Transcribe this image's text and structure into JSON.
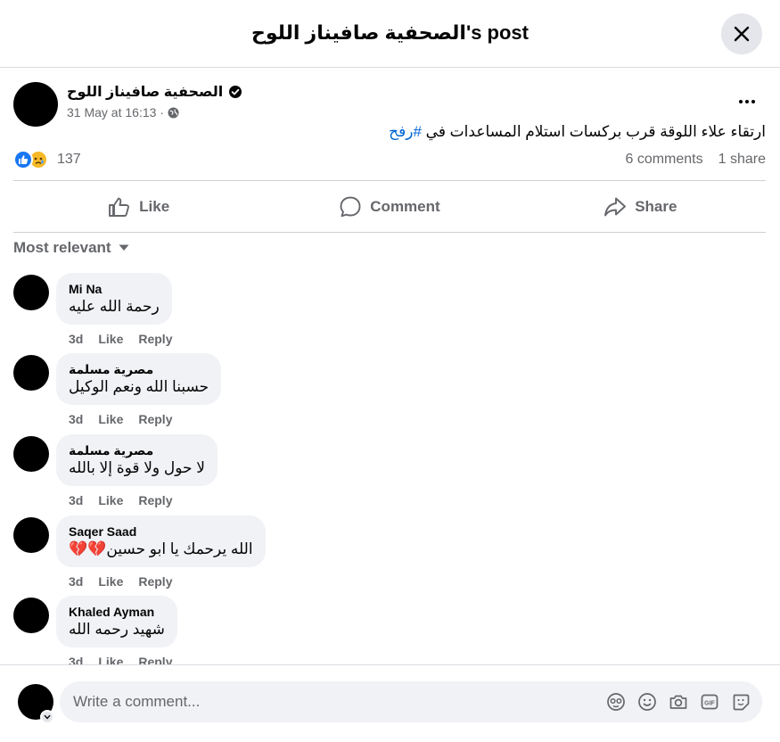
{
  "header": {
    "title": "الصحفية صافيناز اللوح's post"
  },
  "post": {
    "author": "الصحفية صافيناز اللوح",
    "timestamp": "31 May at 16:13 ·",
    "text_main": "ارتقاء علاء اللوقة قرب بركسات استلام المساعدات في ",
    "hashtag": "#رفح",
    "reaction_count": "137",
    "comments_count": "6 comments",
    "shares_count": "1 share"
  },
  "actions": {
    "like": "Like",
    "comment": "Comment",
    "share": "Share"
  },
  "sort": {
    "label": "Most relevant"
  },
  "comments": [
    {
      "name": "Mi Na",
      "text": "رحمة الله عليه",
      "time": "3d",
      "like": "Like",
      "reply": "Reply"
    },
    {
      "name": "مصرية مسلمة",
      "text": "حسبنا الله ونعم الوكيل",
      "time": "3d",
      "like": "Like",
      "reply": "Reply"
    },
    {
      "name": "مصرية مسلمة",
      "text": "لا حول ولا قوة إلا بالله",
      "time": "3d",
      "like": "Like",
      "reply": "Reply"
    },
    {
      "name": "Saqer Saad",
      "text": "الله يرحمك يا ابو حسين💔💔",
      "time": "3d",
      "like": "Like",
      "reply": "Reply"
    },
    {
      "name": "Khaled Ayman",
      "text": "شهيد رحمه الله",
      "time": "3d",
      "like": "Like",
      "reply": "Reply"
    }
  ],
  "composer": {
    "placeholder": "Write a comment..."
  },
  "colors": {
    "accent": "#1877f2",
    "hashtag": "#0064d1",
    "muted": "#65676b",
    "bubble": "#f0f2f5"
  },
  "icons": [
    "close-icon",
    "verified-icon",
    "globe-icon",
    "more-icon",
    "like-icon",
    "comment-icon",
    "share-icon",
    "caret-down-icon",
    "avatar-sticker-icon",
    "emoji-icon",
    "camera-icon",
    "gif-icon",
    "sticker-icon"
  ]
}
